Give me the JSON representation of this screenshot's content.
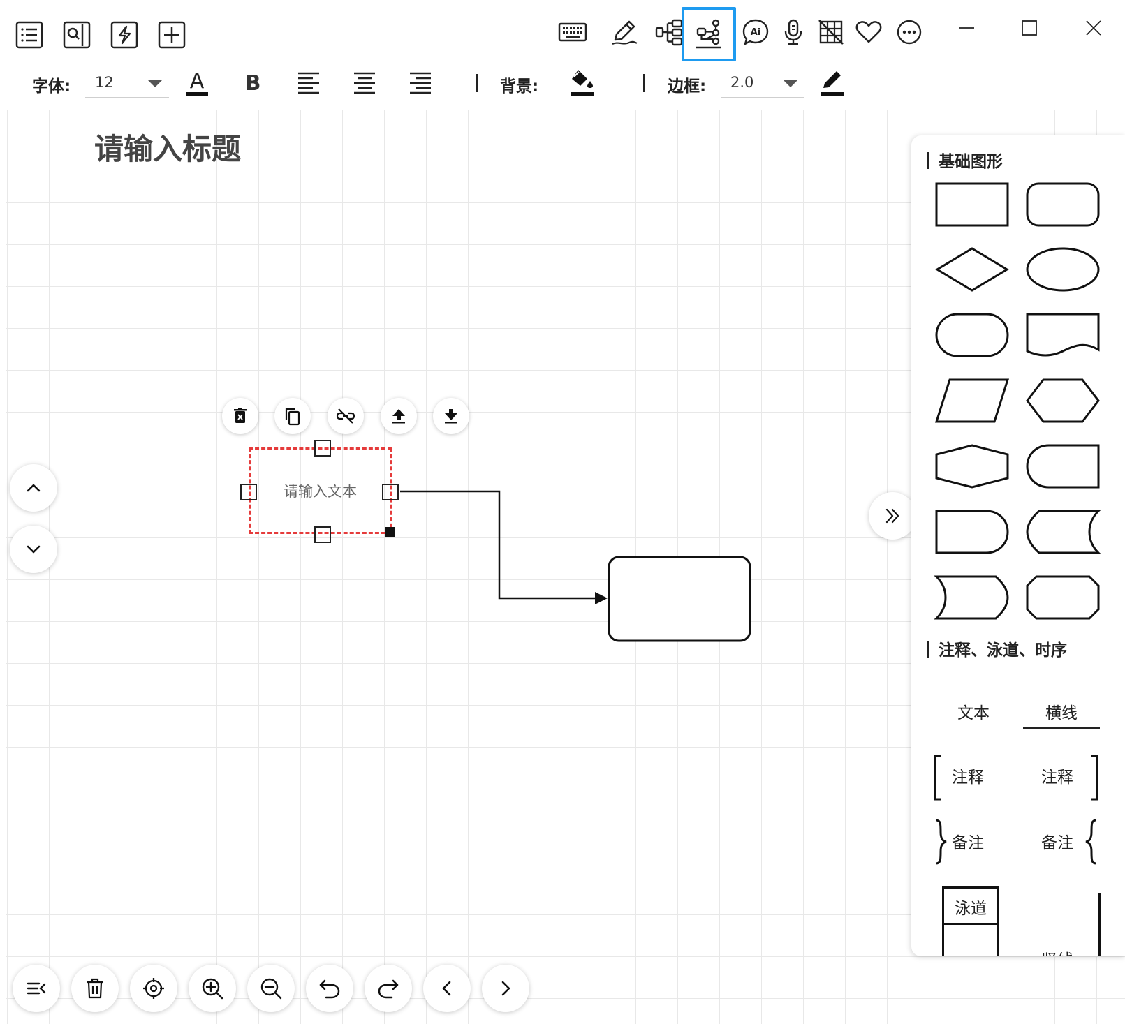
{
  "toolbar": {
    "left_icons": [
      "outline-icon",
      "search-doc-icon",
      "lightning-icon",
      "add-icon"
    ],
    "tools": [
      "keyboard-icon",
      "pen-icon",
      "mindmap-icon",
      "flowchart-icon",
      "ai-chat-icon",
      "microphone-icon",
      "grid-off-icon",
      "heart-icon",
      "more-icon"
    ],
    "active_tool": "flowchart-icon",
    "window_controls": [
      "minimize-icon",
      "maximize-icon",
      "close-icon"
    ],
    "accent_color": "#1e9bf0"
  },
  "format": {
    "font_label": "字体:",
    "font_size": "12",
    "background_label": "背景:",
    "border_label": "边框:",
    "border_width": "2.0"
  },
  "canvas": {
    "title": "请输入标题",
    "selected_node_text": "请输入文本",
    "selection_color": "#e53b3b",
    "node_actions": [
      "delete-icon",
      "copy-icon",
      "unlink-icon",
      "bring-forward-icon",
      "send-backward-icon"
    ],
    "bottom_actions": [
      "collapse-menu-icon",
      "trash-icon",
      "locate-icon",
      "zoom-in-icon",
      "zoom-out-icon",
      "undo-icon",
      "redo-icon",
      "prev-icon",
      "next-icon"
    ]
  },
  "panel": {
    "basic_heading": "基础图形",
    "basic_shapes": [
      "rectangle",
      "rounded-rectangle",
      "diamond",
      "ellipse",
      "terminator",
      "document",
      "parallelogram",
      "hexagon",
      "preparation",
      "card",
      "delay",
      "stored-data",
      "stored-data-reverse",
      "octagon"
    ],
    "annotation_heading": "注释、泳道、时序",
    "tabs": [
      "文本",
      "横线"
    ],
    "active_tab": "横线",
    "annotation_left": "注释",
    "annotation_right": "注释",
    "note_left": "备注",
    "note_right": "备注",
    "swimlane": "泳道",
    "partial_label": "竖线"
  }
}
